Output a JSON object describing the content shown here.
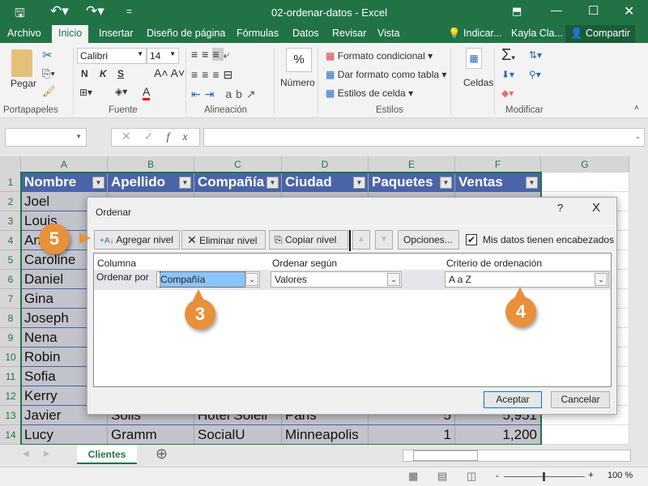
{
  "window": {
    "title": "02-ordenar-datos  -  Excel",
    "qat_customize": "="
  },
  "tabs": [
    "Archivo",
    "Inicio",
    "Insertar",
    "Diseño de página",
    "Fórmulas",
    "Datos",
    "Revisar",
    "Vista"
  ],
  "tell_me": "Indicar...",
  "user": "Kayla Cla...",
  "share": "Compartir",
  "ribbon": {
    "clipboard": {
      "paste": "Pegar",
      "label": "Portapapeles"
    },
    "font": {
      "name": "Calibri",
      "size": "14",
      "bold": "N",
      "italic": "K",
      "underline": "S",
      "label": "Fuente"
    },
    "alignment": {
      "label": "Alineación"
    },
    "number": {
      "percent": "%",
      "label": "Número"
    },
    "styles": {
      "conditional": "Formato condicional",
      "table": "Dar formato como tabla",
      "cell_styles": "Estilos de celda",
      "label": "Estilos"
    },
    "cells": {
      "label": "Celdas"
    },
    "editing": {
      "label": "Modificar"
    }
  },
  "formula_bar": {
    "name_box": "",
    "fx": "fx",
    "value": ""
  },
  "columns": [
    "A",
    "B",
    "C",
    "D",
    "E",
    "F",
    "G"
  ],
  "headers": [
    "Nombre",
    "Apellido",
    "Compañía",
    "Ciudad",
    "Paquetes",
    "Ventas"
  ],
  "rows": [
    [
      "Joel",
      "",
      "",
      "",
      "",
      ""
    ],
    [
      "Louis"
    ],
    [
      "An"
    ],
    [
      "Caroline"
    ],
    [
      "Daniel"
    ],
    [
      "Gina"
    ],
    [
      "Joseph"
    ],
    [
      "Nena"
    ],
    [
      "Robin"
    ],
    [
      "Sofia"
    ],
    [
      "Kerry"
    ],
    [
      "Javier",
      "Solis",
      "Hotel Soleil",
      "Paris",
      "5",
      "5,951"
    ],
    [
      "Lucy",
      "Gramm",
      "SocialU",
      "Minneapolis",
      "1",
      "1,200"
    ]
  ],
  "dialog": {
    "title": "Ordenar",
    "help": "?",
    "close": "X",
    "add_level": "Agregar nivel",
    "delete_level": "Eliminar nivel",
    "copy_level": "Copiar nivel",
    "options": "Opciones...",
    "has_headers": "Mis datos tienen encabezados",
    "has_headers_checked": true,
    "col_headers": [
      "Columna",
      "Ordenar según",
      "Criterio de ordenación"
    ],
    "sort_by_label": "Ordenar por",
    "column_value": "Compañía",
    "sort_on_value": "Valores",
    "order_value": "A a Z",
    "ok": "Aceptar",
    "cancel": "Cancelar"
  },
  "callouts": [
    "5",
    "3",
    "4"
  ],
  "callout_color": "#e8903a",
  "sheet_tab": "Clientes",
  "status": {
    "zoom": "100 %",
    "zoom_level": 100
  },
  "accent": "#217346"
}
